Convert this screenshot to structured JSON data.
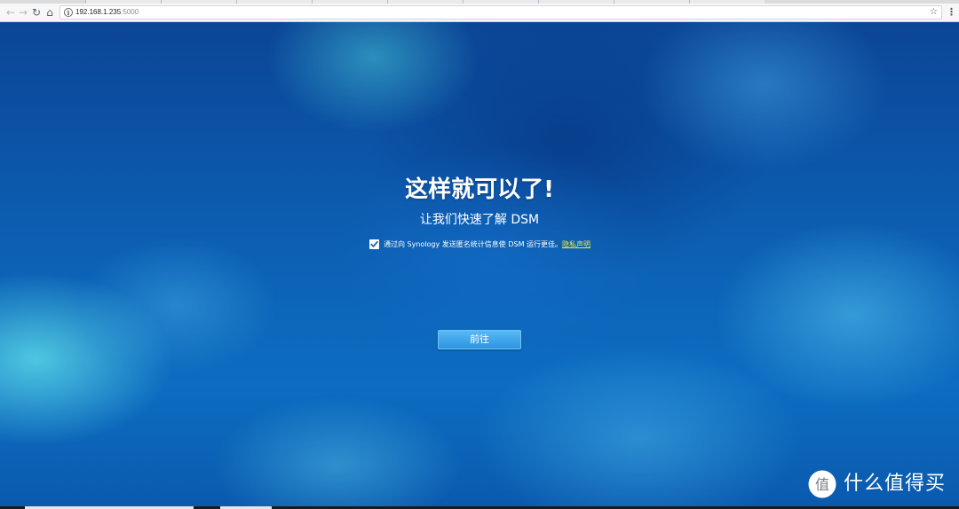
{
  "browser": {
    "url_host": "192.168.1.235",
    "url_port": ":5000",
    "back_icon": "arrow-left-icon",
    "forward_icon": "arrow-right-icon",
    "reload_icon": "reload-icon",
    "home_icon": "home-icon",
    "bookmark_icon": "star-icon",
    "menu_icon": "kebab-menu-icon"
  },
  "welcome": {
    "title": "这样就可以了!",
    "subtitle": "让我们快速了解 DSM",
    "consent_checked": true,
    "consent_text": "通过向 Synology 发送匿名统计信息使 DSM 运行更佳。",
    "privacy_link": "隐私声明",
    "go_button": "前往"
  },
  "watermark": {
    "text": "什么值得买",
    "logo_glyph": "值"
  },
  "colors": {
    "background": "#0c5fb3",
    "button": "#2c94e2",
    "link": "#f2e640"
  }
}
